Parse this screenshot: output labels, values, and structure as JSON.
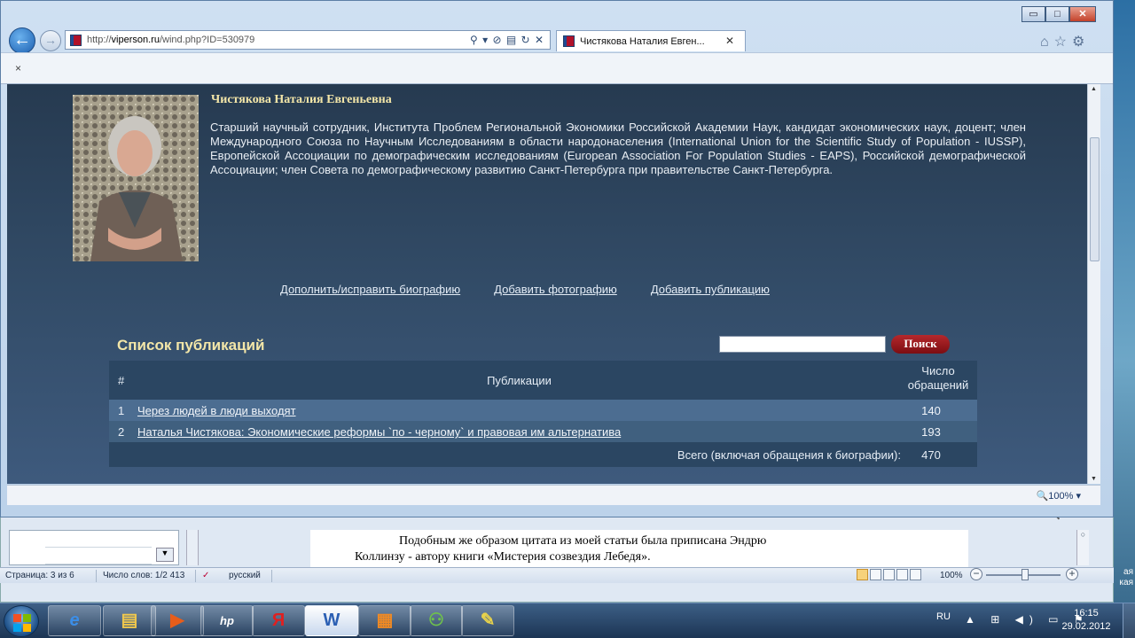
{
  "browser": {
    "url_prefix": "http://",
    "url_host": "viperson.ru",
    "url_path": "/wind.php?ID=530979",
    "address_tools": "⚲ ▾ ⊘ ▤ ↻ ✕",
    "tab_title": "Чистякова Наталия Евген...",
    "tab_close": "✕",
    "cmdbar_close": "×",
    "zoom": "🔍100%  ▾",
    "right_icons": "⌂☆⚙",
    "window_buttons": {
      "min": "▭",
      "max": "□",
      "close": "✕"
    }
  },
  "profile": {
    "name": "Чистякова Наталия Евгеньевна",
    "bio": "Старший научный сотрудник, Института Проблем Региональной Экономики Российской Академии Наук, кандидат экономических наук, доцент; член Международного Союза по Научным Исследованиям в области народонаселения (International Union for the Scientific Study of Population - IUSSP), Европейской Ассоциации по демографическим исследованиям (European Association For Population Studies - EAPS), Российской демографической Ассоциации; член Совета по демографическому развитию Санкт-Петербурга при правительстве Санкт-Петербурга.",
    "links": [
      "Дополнить/исправить биографию",
      "Добавить фотографию",
      "Добавить публикацию"
    ]
  },
  "publications": {
    "title": "Список публикаций",
    "search_button": "Поиск",
    "search_value": "",
    "columns": {
      "num": "#",
      "title": "Публикации",
      "count": "Число обращений"
    },
    "rows": [
      {
        "num": "1",
        "title": "Через людей в люди выходят",
        "count": "140"
      },
      {
        "num": "2",
        "title": "Наталья Чистякова: Экономические реформы `по - черному` и правовая им альтернатива",
        "count": "193"
      }
    ],
    "total_label": "Всего (включая обращения к биографии):",
    "total_value": "470"
  },
  "word": {
    "zoom": "🔍100%  ▾",
    "line1": "Подобным же образом цитата из моей статьи была приписана Эндрю",
    "line2": "Коллинзу - автору книги «Мистерия созвездия Лебедя».",
    "status_page": "Страница: 3 из 6",
    "status_words": "Число слов: 1/2 413",
    "status_lang": "русский",
    "status_zoom": "100%",
    "zoom_minus": "−",
    "zoom_plus": "+",
    "scroll_glyph": "○"
  },
  "desktop": {
    "side_text": "ая\nкая"
  },
  "taskbar": {
    "apps": [
      "e",
      "▤",
      "▶",
      "hp",
      "Я",
      "W",
      "▦",
      "⚇",
      "✎"
    ],
    "lang": "RU",
    "tray": "▲ ⊞ ◀) ▭ ⚑",
    "time": "16:15",
    "date": "29.02.2012"
  },
  "colors": {
    "page_bg": "#314a65",
    "accent_gold": "#f3e6a8",
    "search_red": "#9b1a1e"
  }
}
